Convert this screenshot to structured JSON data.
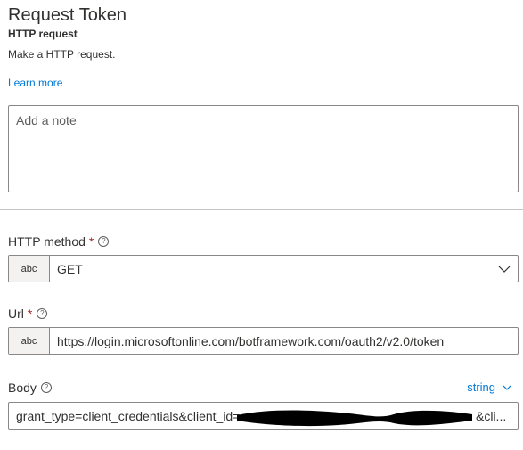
{
  "header": {
    "title": "Request Token",
    "subtitle": "HTTP request",
    "description": "Make a HTTP request.",
    "learn_more": "Learn more"
  },
  "note": {
    "placeholder": "Add a note"
  },
  "fields": {
    "method": {
      "label": "HTTP method",
      "required_marker": "*",
      "type_chip": "abc",
      "value": "GET"
    },
    "url": {
      "label": "Url",
      "required_marker": "*",
      "type_chip": "abc",
      "value": "https://login.microsoftonline.com/botframework.com/oauth2/v2.0/token"
    },
    "body": {
      "label": "Body",
      "type_toggle": "string",
      "value_start": "grant_type=client_credentials&client_id=",
      "value_end": "&cli..."
    }
  },
  "colors": {
    "accent": "#0078d4",
    "required": "#a4262c",
    "border": "#8a8886"
  },
  "icons": {
    "info": "info-icon",
    "chevron": "chevron-down-icon"
  }
}
